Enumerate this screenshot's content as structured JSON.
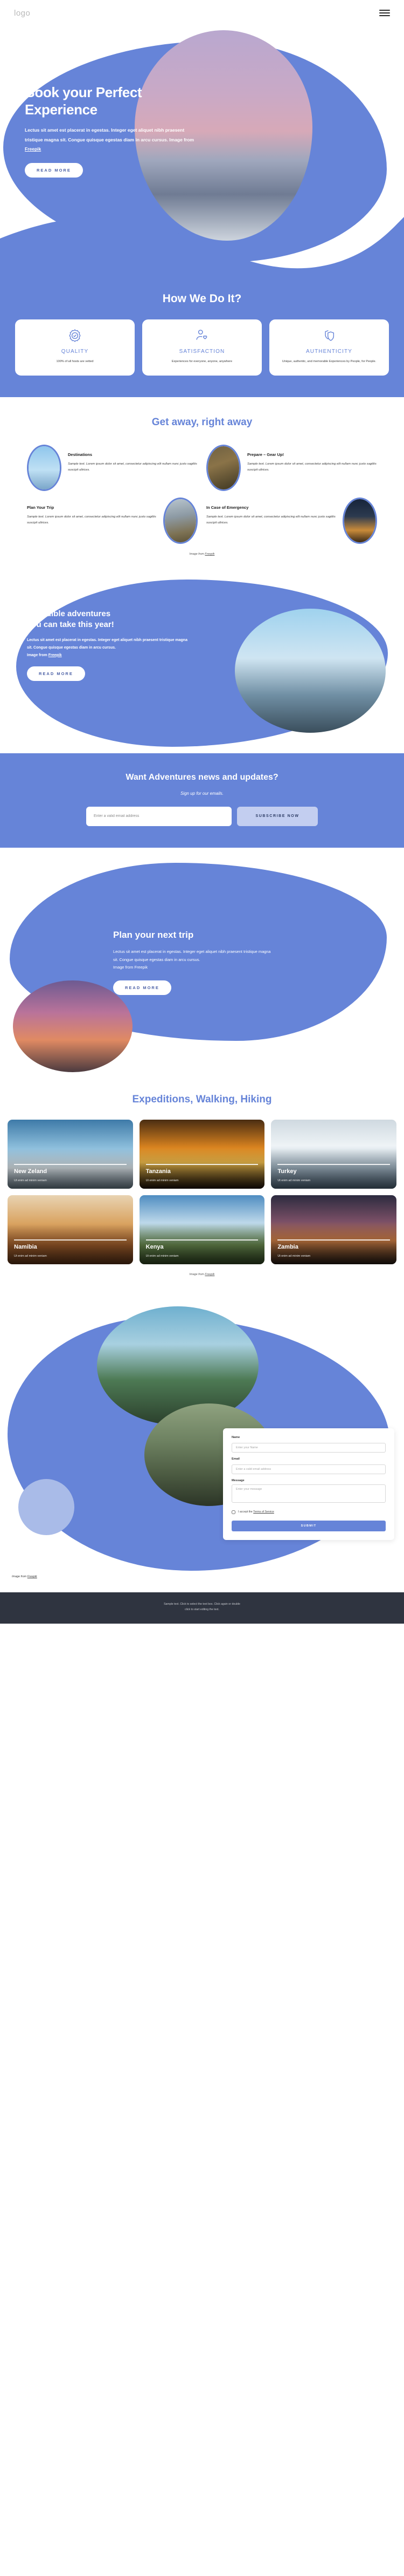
{
  "brand": {
    "accent": "#6684d8",
    "accent_light": "#c3cef0",
    "dark": "#2f3440"
  },
  "header": {
    "logo": "logo",
    "menu_icon": "hamburger-icon"
  },
  "hero": {
    "title_line1": "Book your Perfect",
    "title_line2": "Experience",
    "body": "Lectus sit amet est placerat in egestas. Integer eget aliquet nibh praesent tristique magna sit. Congue quisque egestas diam in arcu cursus. Image from ",
    "credit_link": "Freepik",
    "cta": "READ MORE"
  },
  "how_we_do_it": {
    "title": "How We Do It?",
    "cards": [
      {
        "icon": "badge-check-icon",
        "title": "QUALITY",
        "text": "100% of all hosts are vetted"
      },
      {
        "icon": "person-heart-icon",
        "title": "SATISFACTION",
        "text": "Experiences for everyone, anyone, anywhere"
      },
      {
        "icon": "shields-icon",
        "title": "AUTHENTICITY",
        "text": "Unique, authentic, and memorable Experiences by People, for People."
      }
    ]
  },
  "get_away": {
    "title": "Get away, right away",
    "body": "Sample text. Lorem ipsum dolor sit amet, consectetur adipiscing elit nullam nunc justo sagittis suscipit ultrices.",
    "items": [
      {
        "title": "Destinations",
        "image": "couple-sky-photo"
      },
      {
        "title": "Prepare – Gear Up!",
        "image": "backpacker-forest-photo"
      },
      {
        "title": "Plan Your Trip",
        "image": "tent-mountain-photo"
      },
      {
        "title": "In Case of Emergency",
        "image": "glamping-night-photo"
      }
    ],
    "credit_prefix": "Image from ",
    "credit_link": "Freepik"
  },
  "adventures": {
    "title_line1": "Incredible adventures",
    "title_line2": "you can take this year!",
    "body": "Lectus sit amet est placerat in egestas. Integer eget aliquet nibh praesent tristique magna sit. Congue quisque egestas diam in arcu cursus.",
    "credit_prefix": "Image from ",
    "credit_link": "Freepik",
    "cta": "READ MORE",
    "image": "hikers-ridge-photo"
  },
  "newsletter": {
    "title": "Want Adventures news and updates?",
    "subtitle": "Sign up for our emails.",
    "email_placeholder": "Enter a valid email address",
    "email_value": "",
    "cta": "SUBSCRIBE NOW"
  },
  "plan_trip": {
    "title": "Plan your next trip",
    "body": "Lectus sit amet est placerat in egestas. Integer eget aliquet nibh praesent tristique magna sit. Congue quisque egestas diam in arcu cursus.",
    "credit_prefix": "Image from ",
    "credit_link": "Freepik",
    "cta": "READ MORE",
    "image": "sunset-mountain-photo"
  },
  "expeditions": {
    "title": "Expeditions, Walking, Hiking",
    "cards": [
      {
        "name": "New Zeland",
        "subtitle": "Ut enim ad minim veniam",
        "image": "nz-lake-road-photo"
      },
      {
        "name": "Tanzania",
        "subtitle": "Ut enim ad minim veniam",
        "image": "savanna-sunset-photo"
      },
      {
        "name": "Turkey",
        "subtitle": "Ut enim ad minim veniam",
        "image": "hiker-snow-photo"
      },
      {
        "name": "Namibia",
        "subtitle": "Ut enim ad minim veniam",
        "image": "desert-dunes-photo"
      },
      {
        "name": "Kenya",
        "subtitle": "Ut enim ad minim veniam",
        "image": "green-valley-photo"
      },
      {
        "name": "Zambia",
        "subtitle": "Ut enim ad minim veniam",
        "image": "dramatic-sky-photo"
      }
    ],
    "credit_prefix": "Image from ",
    "credit_link": "Freepik"
  },
  "contact": {
    "fields": [
      {
        "label": "Name",
        "placeholder": "Enter your Name",
        "value": ""
      },
      {
        "label": "Email",
        "placeholder": "Enter a valid email address",
        "value": ""
      }
    ],
    "message_label": "Message",
    "message_placeholder": "Enter your message",
    "message_value": "",
    "consent_prefix": "I accept the ",
    "consent_link": "Terms of Service",
    "submit": "SUBMIT",
    "credit_prefix": "Image from ",
    "credit_link": "Freepik"
  },
  "footer": {
    "line1": "Sample text. Click to select the text box. Click again or double",
    "line2": "click to start editing the text."
  }
}
